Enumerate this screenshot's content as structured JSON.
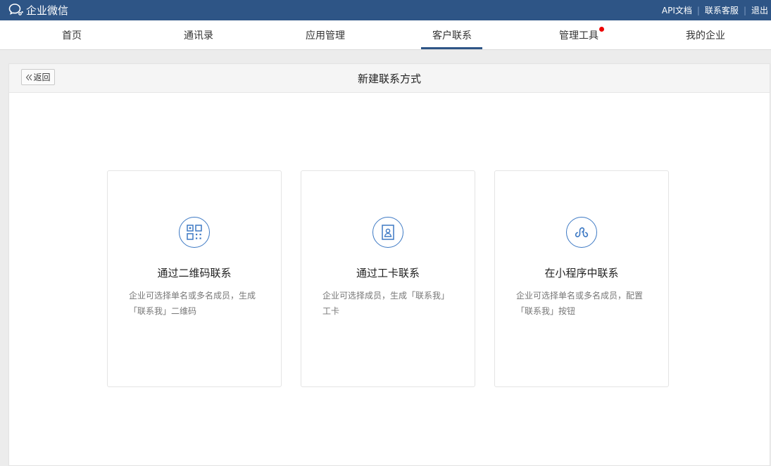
{
  "header": {
    "logo_icon": "wechat-work-logo-icon",
    "app_name": "企业微信",
    "links": {
      "api_docs": "API文档",
      "contact_service": "联系客服",
      "logout": "退出"
    }
  },
  "nav": {
    "items": [
      {
        "label": "首页"
      },
      {
        "label": "通讯录"
      },
      {
        "label": "应用管理"
      },
      {
        "label": "客户联系",
        "active": true
      },
      {
        "label": "管理工具",
        "badge": "red-dot"
      },
      {
        "label": "我的企业"
      }
    ]
  },
  "panel": {
    "back_label": "返回",
    "title": "新建联系方式"
  },
  "cards": [
    {
      "icon": "qr-code-icon",
      "title": "通过二维码联系",
      "desc_line1": "企业可选择单名或多名成员，生成",
      "desc_line2": "「联系我」二维码"
    },
    {
      "icon": "badge-card-icon",
      "title": "通过工卡联系",
      "desc_line1": "企业可选择成员，生成「联系我」",
      "desc_line2": "工卡"
    },
    {
      "icon": "mini-program-icon",
      "title": "在小程序中联系",
      "desc_line1": "企业可选择单名或多名成员，配置",
      "desc_line2": "「联系我」按钮"
    }
  ],
  "colors": {
    "topbar": "#2e5586",
    "accent": "#3d79c4",
    "badge": "#e00000"
  }
}
